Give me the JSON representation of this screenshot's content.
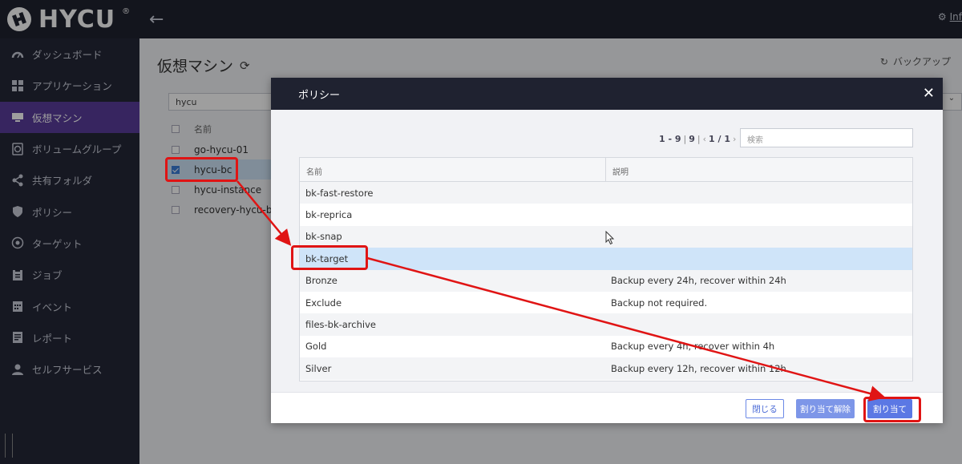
{
  "app": {
    "brand": "HYCU",
    "user": "Inf"
  },
  "sidebar": {
    "items": [
      {
        "label": "ダッシュボード",
        "icon": "dashboard-icon"
      },
      {
        "label": "アプリケーション",
        "icon": "apps-grid-icon"
      },
      {
        "label": "仮想マシン",
        "icon": "monitor-icon",
        "active": true
      },
      {
        "label": "ボリュームグループ",
        "icon": "disk-icon"
      },
      {
        "label": "共有フォルダ",
        "icon": "share-icon"
      },
      {
        "label": "ポリシー",
        "icon": "shield-icon"
      },
      {
        "label": "ターゲット",
        "icon": "target-icon"
      },
      {
        "label": "ジョブ",
        "icon": "clipboard-icon"
      },
      {
        "label": "イベント",
        "icon": "calendar-icon"
      },
      {
        "label": "レポート",
        "icon": "report-icon"
      },
      {
        "label": "セルフサービス",
        "icon": "user-service-icon"
      }
    ]
  },
  "main": {
    "title": "仮想マシン",
    "backup_label": "バックアップ",
    "filter_value": "hycu",
    "name_header": "名前",
    "vms": [
      {
        "name": "go-hycu-01",
        "checked": false
      },
      {
        "name": "hycu-bc",
        "checked": true
      },
      {
        "name": "hycu-instance",
        "checked": false
      },
      {
        "name": "recovery-hycu-bc",
        "checked": false
      }
    ]
  },
  "modal": {
    "title": "ポリシー",
    "pager": {
      "range": "1 - 9",
      "total": "9",
      "page": "1 / 1"
    },
    "search_placeholder": "検索",
    "columns": {
      "name": "名前",
      "description": "説明"
    },
    "rows": [
      {
        "name": "bk-fast-restore",
        "description": ""
      },
      {
        "name": "bk-reprica",
        "description": ""
      },
      {
        "name": "bk-snap",
        "description": ""
      },
      {
        "name": "bk-target",
        "description": "",
        "selected": true
      },
      {
        "name": "Bronze",
        "description": "Backup every 24h, recover within 24h"
      },
      {
        "name": "Exclude",
        "description": "Backup not required."
      },
      {
        "name": "files-bk-archive",
        "description": ""
      },
      {
        "name": "Gold",
        "description": "Backup every 4h, recover within 4h"
      },
      {
        "name": "Silver",
        "description": "Backup every 12h, recover within 12h"
      }
    ],
    "buttons": {
      "close": "閉じる",
      "unassign": "割り当て解除",
      "assign": "割り当て"
    }
  },
  "colors": {
    "accent": "#5a3d9c",
    "topbar": "#1f2230",
    "annotation": "#e01414",
    "primary_button": "#5b78e4"
  }
}
